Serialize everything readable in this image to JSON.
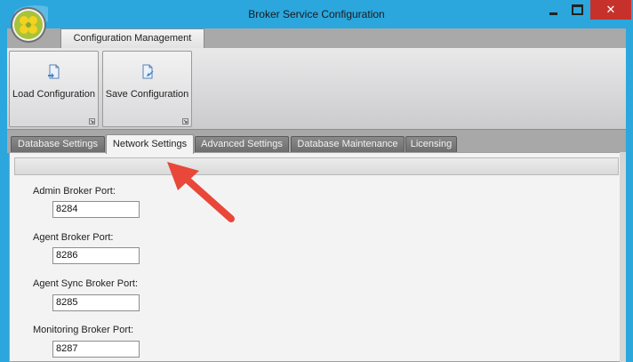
{
  "window": {
    "title": "Broker Service Configuration",
    "icon": "app-logo-icon",
    "controls": {
      "minimize": "minimize-icon",
      "maximize": "maximize-icon",
      "close": "✕"
    }
  },
  "ribbon": {
    "tabs": [
      {
        "label": "Configuration Management",
        "active": true
      }
    ],
    "buttons": [
      {
        "label": "Load Configuration",
        "icon": "load-document-icon"
      },
      {
        "label": "Save Configuration",
        "icon": "save-document-icon"
      }
    ]
  },
  "tabs": [
    {
      "label": "Database Settings",
      "active": false
    },
    {
      "label": "Network Settings",
      "active": true
    },
    {
      "label": "Advanced Settings",
      "active": false
    },
    {
      "label": "Database Maintenance",
      "active": false
    },
    {
      "label": "Licensing",
      "active": false
    }
  ],
  "network": {
    "fields": [
      {
        "label": "Admin Broker Port:",
        "value": "8284"
      },
      {
        "label": "Agent Broker Port:",
        "value": "8286"
      },
      {
        "label": "Agent Sync Broker Port:",
        "value": "8285"
      },
      {
        "label": "Monitoring Broker Port:",
        "value": "8287"
      }
    ]
  },
  "colors": {
    "titlebar": "#2ba7de",
    "close_button": "#c7312b",
    "annotation_arrow": "#e8473a"
  }
}
